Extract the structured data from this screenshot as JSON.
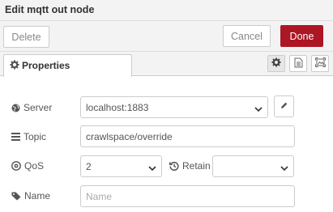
{
  "dialog": {
    "title": "Edit mqtt out node"
  },
  "toolbar": {
    "delete_label": "Delete",
    "cancel_label": "Cancel",
    "done_label": "Done"
  },
  "tabs": {
    "properties_label": "Properties"
  },
  "form": {
    "server": {
      "label": "Server",
      "value": "localhost:1883"
    },
    "topic": {
      "label": "Topic",
      "value": "crawlspace/override"
    },
    "qos": {
      "label": "QoS",
      "value": "2"
    },
    "retain": {
      "label": "Retain",
      "value": ""
    },
    "name": {
      "label": "Name",
      "value": "",
      "placeholder": "Name"
    }
  },
  "colors": {
    "done_bg": "#ad1625",
    "toolbar_bg": "#f3f3f3"
  },
  "icons": [
    "gear-icon",
    "document-icon",
    "frame-icon",
    "globe-icon",
    "pencil-icon",
    "list-icon",
    "qos-icon",
    "history-icon",
    "tag-icon",
    "chevron-down-icon"
  ]
}
